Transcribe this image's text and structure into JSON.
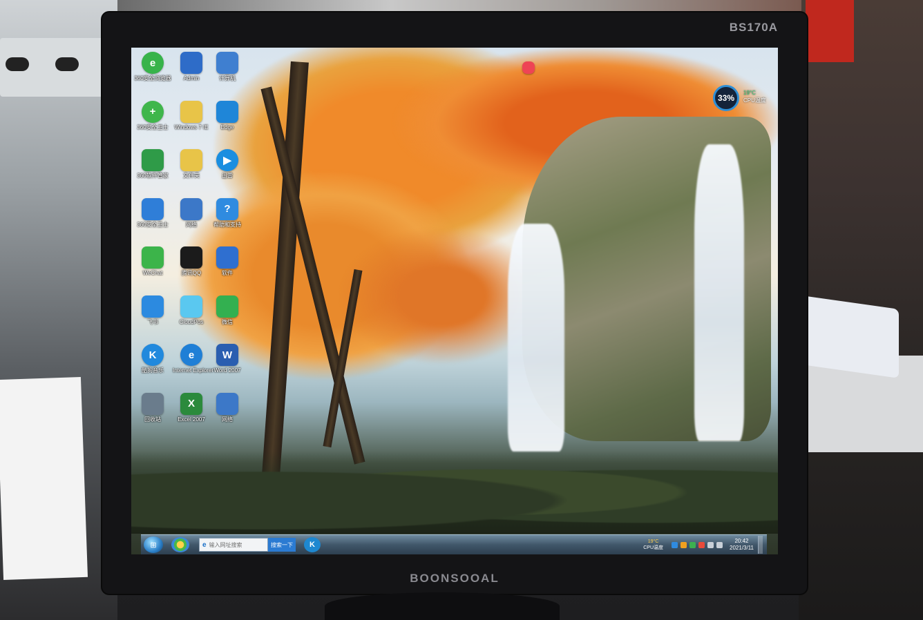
{
  "monitor": {
    "model": "BS170A",
    "brand": "BOONSOOAL"
  },
  "desktop": {
    "icons": [
      {
        "label": "360安全浏览器",
        "icon": "360-browser-icon",
        "color": "#37b34a",
        "glyph": "e"
      },
      {
        "label": "Admin",
        "icon": "user-folder-icon",
        "color": "#2e6cc8",
        "glyph": ""
      },
      {
        "label": "计算机",
        "icon": "computer-icon",
        "color": "#3f7fd0",
        "glyph": ""
      },
      {
        "label": "360安全卫士",
        "icon": "360-safe-icon",
        "color": "#3fb64b",
        "glyph": "+"
      },
      {
        "label": "Windows 7 IE",
        "icon": "folder-icon",
        "color": "#e8c448",
        "glyph": ""
      },
      {
        "label": "Edge",
        "icon": "edge-icon",
        "color": "#1f86d8",
        "glyph": ""
      },
      {
        "label": "360软件管家",
        "icon": "360-software-icon",
        "color": "#2f9b48",
        "glyph": ""
      },
      {
        "label": "文件夹",
        "icon": "folder-icon",
        "color": "#e8c448",
        "glyph": ""
      },
      {
        "label": "迅雷",
        "icon": "play-icon",
        "color": "#1a8ee0",
        "glyph": "▶"
      },
      {
        "label": "360安全卫士",
        "icon": "shield-icon",
        "color": "#2f7ed8",
        "glyph": ""
      },
      {
        "label": "网络",
        "icon": "network-icon",
        "color": "#3c78c8",
        "glyph": ""
      },
      {
        "label": "帮助和支持",
        "icon": "help-icon",
        "color": "#2f8be0",
        "glyph": "?"
      },
      {
        "label": "WeChat",
        "icon": "wechat-icon",
        "color": "#3cb44a",
        "glyph": ""
      },
      {
        "label": "腾讯QQ",
        "icon": "qq-icon",
        "color": "#1b1b1b",
        "glyph": ""
      },
      {
        "label": "软件",
        "icon": "app-icon",
        "color": "#2f6fd0",
        "glyph": ""
      },
      {
        "label": "飞书",
        "icon": "bird-icon",
        "color": "#2c8ae0",
        "glyph": ""
      },
      {
        "label": "CloudPos",
        "icon": "cloud-icon",
        "color": "#5ac8f0",
        "glyph": ""
      },
      {
        "label": "微信",
        "icon": "chat-icon",
        "color": "#33b050",
        "glyph": ""
      },
      {
        "label": "酷狗音乐",
        "icon": "kugou-icon",
        "color": "#2189dd",
        "glyph": "K"
      },
      {
        "label": "Internet Explorer",
        "icon": "ie-icon",
        "color": "#1f7fd6",
        "glyph": "e"
      },
      {
        "label": "Word 2007",
        "icon": "word-icon",
        "color": "#2a5eb0",
        "glyph": "W"
      },
      {
        "label": "回收站",
        "icon": "recycle-bin-icon",
        "color": "#6a7c8c",
        "glyph": ""
      },
      {
        "label": "Excel 2007",
        "icon": "excel-icon",
        "color": "#2b8a3c",
        "glyph": "X"
      },
      {
        "label": "网络",
        "icon": "network-icon",
        "color": "#3c78c8",
        "glyph": ""
      }
    ],
    "top_icon": {
      "icon": "shirt-icon"
    },
    "cpu_widget": {
      "usage": "33%",
      "temp": "19°C",
      "label": "CPU温度"
    }
  },
  "taskbar": {
    "search_placeholder": "输入网址搜索",
    "search_button": "搜索一下",
    "app_glyph": "K",
    "tray_temp": "19°C",
    "tray_label": "CPU温度",
    "time": "20:42",
    "date": "2021/3/11"
  }
}
